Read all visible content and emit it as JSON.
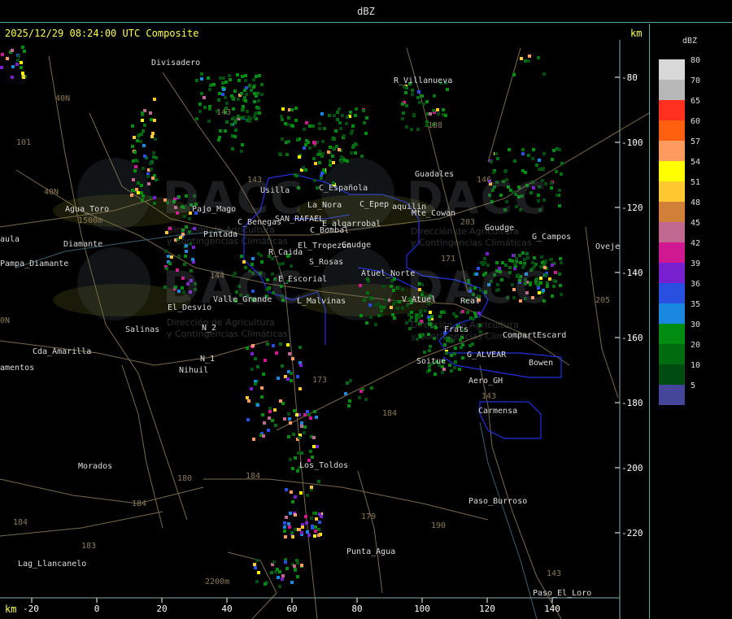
{
  "header": {
    "title": "dBZ"
  },
  "info": {
    "timestamp_product": "2025/12/29 08:24:00 UTC Composite",
    "unit": "km"
  },
  "axes": {
    "x_ticks": [
      "-20",
      "0",
      "20",
      "40",
      "60",
      "80",
      "100",
      "120",
      "140"
    ],
    "y_ticks": [
      "-80",
      "-100",
      "-120",
      "-140",
      "-160",
      "-180",
      "-200",
      "-220"
    ]
  },
  "legend": {
    "title": "dBZ",
    "values": [
      "80",
      "70",
      "65",
      "60",
      "57",
      "54",
      "51",
      "48",
      "45",
      "42",
      "39",
      "36",
      "35",
      "30",
      "20",
      "10",
      "5"
    ],
    "colors": [
      "#d8d8d8",
      "#b8b8b8",
      "#ff3020",
      "#ff6010",
      "#ff9a60",
      "#ffff00",
      "#ffc830",
      "#d08038",
      "#c06890",
      "#d01890",
      "#7820d0",
      "#2850e0",
      "#1a88e0",
      "#008c10",
      "#006c10",
      "#004c10",
      "#45459a"
    ]
  },
  "places": {
    "divisadero": "Divisadero",
    "villanueva": "R_Villanueva",
    "guadales": "Guadales",
    "agua_toro": "Agua_Toro",
    "usilla": "Usilla",
    "espanola": "C_Española",
    "la_nora": "La_Nora",
    "epeyon": "C_Epep",
    "aquilin": "aquilin",
    "cowan": "Mte_Cowan",
    "goudge_n": "Goudge",
    "c_campos": "G_Campos",
    "pajo_mago": "Pajo_Mago",
    "c_benegas": "C_Benegas",
    "san_rafael": "SAN_RAFAEL",
    "algarrobal": "E_algarrobal",
    "c_bombal": "C_Bombal",
    "pintada": "Pintada",
    "tropezon": "El_Tropezon",
    "goudge": "Goudge",
    "aula": "aula",
    "pampa_diamante": "Pampa_Diamante",
    "rcaida": "R_Caida",
    "s_rosas": "S_Rosas",
    "atuel_norte": "Atuel_Norte",
    "e_escorial": "E_Escorial",
    "el_desvio": "El_Desvio",
    "valle_grande": "Valle_Grande",
    "l_malvinas": "L_Malvinas",
    "v_atuel": "V_Atuel",
    "real": "Real",
    "n_2": "N_2",
    "salinas": "Salinas",
    "frats": "Frats",
    "compart_escard": "CompartEscard",
    "cda_amarilla": "Cda_Amarilla",
    "n_1": "N_1",
    "nihuil": "Nihuil",
    "g_alvear": "G_ALVEAR",
    "bowen": "Bowen",
    "soitue": "Soitue",
    "amentos": "amentos",
    "aeroah": "Aero_GH",
    "carmensa": "Carmensa",
    "los_toldos": "Los_Toldos",
    "morados": "Morados",
    "paso_burroso": "Paso_Burroso",
    "punta_agua": "Punta_Agua",
    "lag_llancanelo": "Lag_Llancanelo",
    "paso_el_loro": "Paso_El_Loro",
    "oveje": "Oveje",
    "campos": "Campos",
    "diamante": "Diamante"
  },
  "routes": {
    "r40n_a": "40N",
    "r40n_b": "40N",
    "r101": "101",
    "r143a": "143",
    "r143b": "143",
    "r144": "144",
    "r173": "173",
    "r171": "171",
    "r146": "146",
    "r203": "203",
    "r205": "205",
    "r188": "188",
    "r179a": "179",
    "r179b": "179",
    "r184a": "184",
    "r184b": "184",
    "r184c": "184",
    "r180a": "180",
    "r180b": "180",
    "r190": "190",
    "r183": "183",
    "r143c": "143",
    "r143d": "143",
    "r0n": "0N",
    "r1500": "1500m",
    "r2200": "2200m"
  },
  "watermark": {
    "brand": "DACC",
    "line1": "Dirección de Agricultura",
    "line2": "y Contingencias Climáticas"
  }
}
